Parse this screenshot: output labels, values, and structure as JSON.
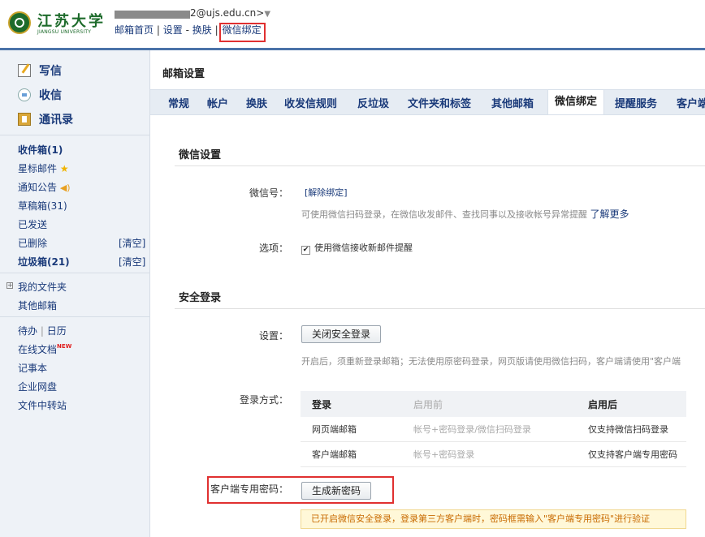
{
  "header": {
    "logo_text": "江苏大学",
    "logo_sub": "JIANGSU UNIVERSITY",
    "email_suffix": "2@ujs.edu.cn>",
    "nav": [
      {
        "label": "邮箱首页"
      },
      {
        "label": "设置"
      },
      {
        "label": "换肤"
      },
      {
        "label": "微信绑定"
      }
    ]
  },
  "sidebar": {
    "main": [
      {
        "label": "写信",
        "icon": "write-icon"
      },
      {
        "label": "收信",
        "icon": "inbox-icon"
      },
      {
        "label": "通讯录",
        "icon": "contacts-icon"
      }
    ],
    "folders": [
      {
        "label": "收件箱(1)"
      },
      {
        "label": "星标邮件"
      },
      {
        "label": "通知公告"
      },
      {
        "label": "草稿箱(31)"
      },
      {
        "label": "已发送"
      },
      {
        "label": "已删除",
        "action": "[清空]"
      },
      {
        "label": "垃圾箱(21)",
        "action": "[清空]"
      }
    ],
    "my_folders": "我的文件夹",
    "other_mailbox": "其他邮箱",
    "todo": "待办",
    "calendar": "日历",
    "tools": [
      {
        "label": "在线文档",
        "badge": "NEW"
      },
      {
        "label": "记事本"
      },
      {
        "label": "企业网盘"
      },
      {
        "label": "文件中转站"
      }
    ]
  },
  "main": {
    "title": "邮箱设置",
    "tabs": [
      {
        "label": "常规"
      },
      {
        "label": "帐户"
      },
      {
        "label": "换肤"
      },
      {
        "label": "收发信规则"
      },
      {
        "label": "反垃圾"
      },
      {
        "label": "文件夹和标签"
      },
      {
        "label": "其他邮箱"
      },
      {
        "label": "微信绑定"
      },
      {
        "label": "提醒服务"
      },
      {
        "label": "客户端"
      }
    ],
    "wechat": {
      "section_title": "微信设置",
      "id_label": "微信号：",
      "unbind_link": "[解除绑定]",
      "hint": "可使用微信扫码登录，在微信收发邮件、查找同事以及接收帐号异常提醒",
      "learn_more": "了解更多",
      "option_label": "选项：",
      "option_text": "使用微信接收新邮件提醒",
      "option_checked": true
    },
    "security": {
      "section_title": "安全登录",
      "setting_label": "设置：",
      "close_button": "关闭安全登录",
      "hint": "开启后，须重新登录邮箱；无法使用原密码登录，网页版请使用微信扫码，客户端请使用\"客户端",
      "method_label": "登录方式：",
      "table": {
        "headers": [
          "登录",
          "启用前",
          "启用后"
        ],
        "rows": [
          [
            "网页端邮箱",
            "帐号+密码登录/微信扫码登录",
            "仅支持微信扫码登录"
          ],
          [
            "客户端邮箱",
            "帐号+密码登录",
            "仅支持客户端专用密码"
          ]
        ]
      },
      "client_pw_label": "客户端专用密码：",
      "generate_button": "生成新密码",
      "notice": "已开启微信安全登录，登录第三方客户端时，密码框需输入\"客户端专用密码\"进行验证"
    }
  }
}
